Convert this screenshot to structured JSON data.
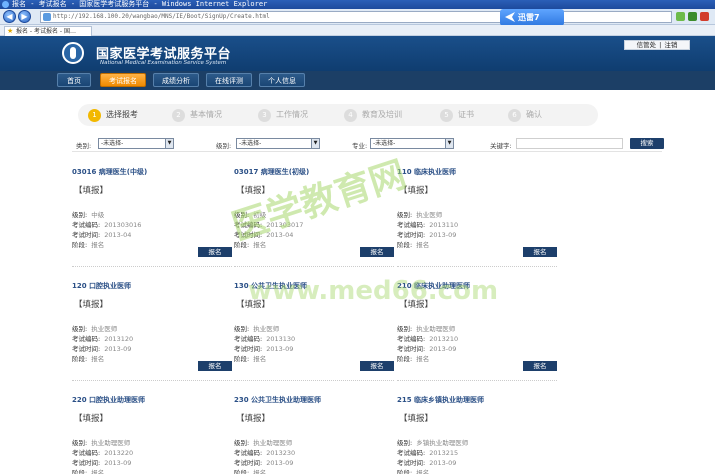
{
  "browser": {
    "title": "报名 - 考试报名 - 国家医学考试服务平台 - Windows Internet Explorer",
    "url": "http://192.168.100.20/wangbao/MNS/IE/Boot/SignUp/Create.html",
    "tab_label": "报名 - 考试报名 - 国…",
    "badge_label": "迅雷7"
  },
  "site": {
    "title": "国家医学考试服务平台",
    "subtitle": "National Medical Examination Service System",
    "user_name": "信管处",
    "logout": "注销"
  },
  "nav": [
    {
      "label": "首页",
      "active": false
    },
    {
      "label": "考试报名",
      "active": true
    },
    {
      "label": "成绩分析",
      "active": false
    },
    {
      "label": "在线评测",
      "active": false
    },
    {
      "label": "个人信息",
      "active": false
    }
  ],
  "steps": [
    {
      "num": "1",
      "label": "选择报考",
      "active": true
    },
    {
      "num": "2",
      "label": "基本情况",
      "active": false
    },
    {
      "num": "3",
      "label": "工作情况",
      "active": false
    },
    {
      "num": "4",
      "label": "教育及培训",
      "active": false
    },
    {
      "num": "5",
      "label": "证书",
      "active": false
    },
    {
      "num": "6",
      "label": "确认",
      "active": false
    }
  ],
  "filters": {
    "category_label": "类别:",
    "category_value": "-未选择-",
    "level_label": "级别:",
    "level_value": "-未选择-",
    "major_label": "专业:",
    "major_value": "-未选择-",
    "keyword_label": "关键字:",
    "search_button": "搜索"
  },
  "card_labels": {
    "fill": "【填报】",
    "level": "级别:",
    "code": "考试编码:",
    "time": "考试时间:",
    "stage": "阶段:",
    "apply": "报名"
  },
  "exams": [
    {
      "name": "03016 病理医生(中级)",
      "level": "中级",
      "code": "201303016",
      "time": "2013-04",
      "stage": "报名"
    },
    {
      "name": "03017 病理医生(初级)",
      "level": "初级",
      "code": "201303017",
      "time": "2013-04",
      "stage": "报名"
    },
    {
      "name": "110 临床执业医师",
      "level": "执业医师",
      "code": "2013110",
      "time": "2013-09",
      "stage": "报名"
    },
    {
      "name": "120 口腔执业医师",
      "level": "执业医师",
      "code": "2013120",
      "time": "2013-09",
      "stage": "报名"
    },
    {
      "name": "130 公共卫生执业医师",
      "level": "执业医师",
      "code": "2013130",
      "time": "2013-09",
      "stage": "报名"
    },
    {
      "name": "210 临床执业助理医师",
      "level": "执业助理医师",
      "code": "2013210",
      "time": "2013-09",
      "stage": "报名"
    },
    {
      "name": "220 口腔执业助理医师",
      "level": "执业助理医师",
      "code": "2013220",
      "time": "2013-09",
      "stage": "报名"
    },
    {
      "name": "230 公共卫生执业助理医师",
      "level": "执业助理医师",
      "code": "2013230",
      "time": "2013-09",
      "stage": "报名"
    },
    {
      "name": "215 临床乡镇执业助理医师",
      "level": "乡镇执业助理医师",
      "code": "2013215",
      "time": "2013-09",
      "stage": "报名"
    }
  ],
  "watermark": {
    "cn": "医学教育网",
    "url": "www.med66.com"
  }
}
